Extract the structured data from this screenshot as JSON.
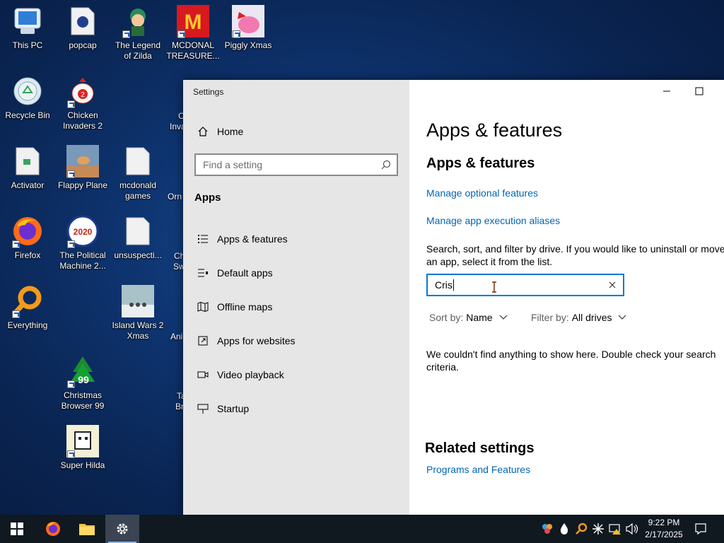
{
  "desktop": {
    "icons": [
      {
        "label": "This PC"
      },
      {
        "label": "popcap"
      },
      {
        "label": "The Legend\nof Zilda"
      },
      {
        "label": "MCDONAL\nTREASURE..."
      },
      {
        "label": "Piggly Xmas"
      },
      {
        "label": "Recycle Bin"
      },
      {
        "label": "Chicken\nInvaders 2"
      },
      {
        "label": "Activator"
      },
      {
        "label": "Flappy Plane"
      },
      {
        "label": "mcdonald\ngames"
      },
      {
        "label": "Firefox"
      },
      {
        "label": "The Political\nMachine 2..."
      },
      {
        "label": "unsuspecti..."
      },
      {
        "label": "Everything"
      },
      {
        "label": "Island Wars 2\nXmas"
      },
      {
        "label": "Christmas\nBrowser 99"
      },
      {
        "label": "Super Hilda"
      }
    ],
    "partial_labels": [
      "C",
      "Inva",
      "Orn",
      "Ch",
      "Sw",
      "Ani",
      "Ta",
      "Br"
    ]
  },
  "settings": {
    "window_title": "Settings",
    "home_label": "Home",
    "search_placeholder": "Find a setting",
    "section_label": "Apps",
    "nav_items": [
      {
        "label": "Apps & features",
        "icon": "list-icon"
      },
      {
        "label": "Default apps",
        "icon": "default-apps-icon"
      },
      {
        "label": "Offline maps",
        "icon": "map-icon"
      },
      {
        "label": "Apps for websites",
        "icon": "web-link-icon"
      },
      {
        "label": "Video playback",
        "icon": "video-icon"
      },
      {
        "label": "Startup",
        "icon": "startup-icon"
      }
    ],
    "page": {
      "title": "Apps & features",
      "subtitle": "Apps & features",
      "link_optional": "Manage optional features",
      "link_aliases": "Manage app execution aliases",
      "description": "Search, sort, and filter by drive. If you would like to uninstall or move an app, select it from the list.",
      "search_value": "Cris",
      "sort_label": "Sort by:",
      "sort_value": "Name",
      "filter_label": "Filter by:",
      "filter_value": "All drives",
      "empty_message": "We couldn't find anything to show here. Double check your search criteria.",
      "related_heading": "Related settings",
      "related_link": "Programs and Features"
    }
  },
  "taskbar": {
    "time": "9:22 PM",
    "date": "2/17/2025",
    "pinned": [
      "start-button",
      "firefox",
      "file-explorer",
      "settings"
    ]
  },
  "colors": {
    "accent": "#0078d7",
    "link": "#0066b4",
    "sidebar_bg": "#e6e6e6",
    "taskbar_bg": "#101820"
  }
}
